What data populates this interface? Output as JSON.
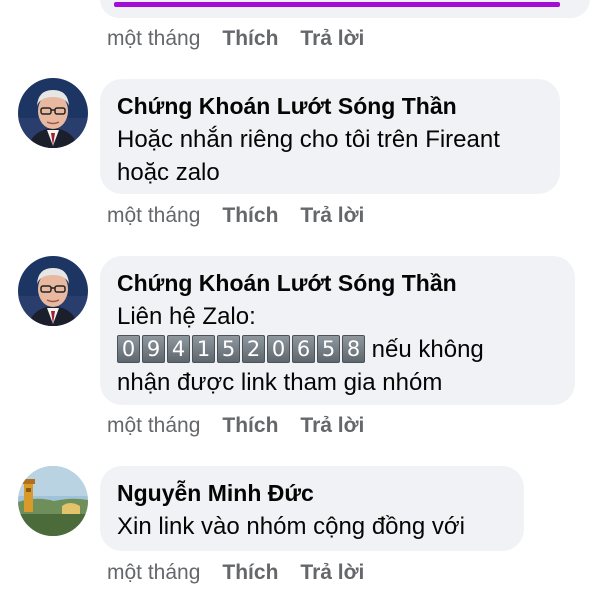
{
  "comments": [
    {
      "actions": {
        "time": "một tháng",
        "like": "Thích",
        "reply": "Trả lời"
      }
    },
    {
      "author": "Chứng Khoán Lướt Sóng Thần",
      "lines": [
        "Hoặc nhắn riêng cho tôi trên Fireant",
        "hoặc zalo"
      ],
      "actions": {
        "time": "một tháng",
        "like": "Thích",
        "reply": "Trả lời"
      }
    },
    {
      "author": "Chứng Khoán Lướt Sóng Thần",
      "line1": "Liên hệ Zalo:",
      "phone_digits": [
        "0",
        "9",
        "4",
        "1",
        "5",
        "2",
        "0",
        "6",
        "5",
        "8"
      ],
      "line2_suffix": "nếu không",
      "line3": "nhận được link tham gia nhóm",
      "actions": {
        "time": "một tháng",
        "like": "Thích",
        "reply": "Trả lời"
      }
    },
    {
      "author": "Nguyễn Minh Đức",
      "lines": [
        "Xin link vào nhóm cộng đồng với"
      ],
      "actions": {
        "time": "một tháng",
        "like": "Thích",
        "reply": "Trả lời"
      }
    }
  ],
  "colors": {
    "bubble_bg": "#f0f2f5",
    "action_text": "#65676b",
    "accent_purple": "#a20ed6"
  }
}
